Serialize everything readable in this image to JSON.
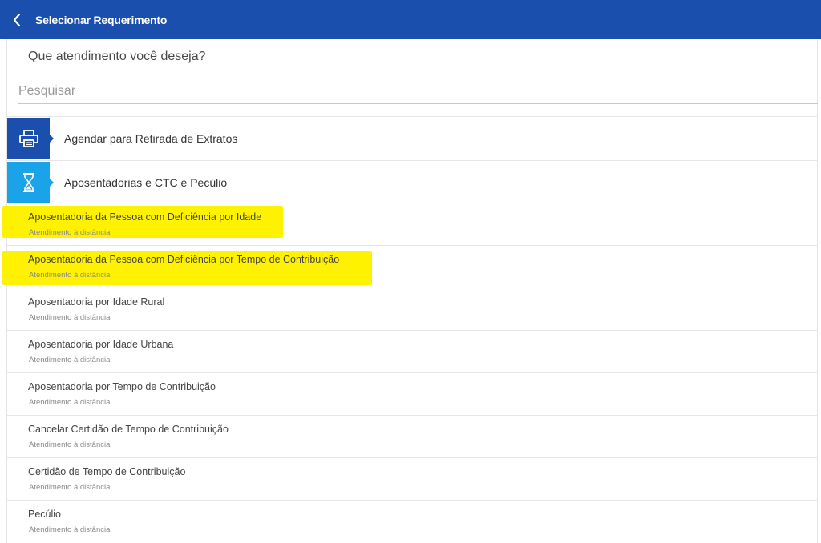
{
  "header": {
    "title": "Selecionar Requerimento",
    "back_icon": "chevron-left-icon",
    "background": "#1a4fae"
  },
  "question": "Que atendimento você deseja?",
  "search": {
    "placeholder": "Pesquisar",
    "value": ""
  },
  "categories": [
    {
      "label": "Agendar para Retirada de Extratos",
      "icon": "printer-icon",
      "color": "#1a4fae"
    },
    {
      "label": "Aposentadorias e CTC e Pecúlio",
      "icon": "hourglass-icon",
      "color": "#1aa3e8"
    }
  ],
  "items": [
    {
      "title": "Aposentadoria da Pessoa com Deficiência por Idade",
      "subtitle": "Atendimento à distância",
      "highlighted": true
    },
    {
      "title": "Aposentadoria da Pessoa com Deficiência por Tempo de Contribuição",
      "subtitle": "Atendimento à distância",
      "highlighted": true
    },
    {
      "title": "Aposentadoria por Idade Rural",
      "subtitle": "Atendimento à distância",
      "highlighted": false
    },
    {
      "title": "Aposentadoria por Idade Urbana",
      "subtitle": "Atendimento à distância",
      "highlighted": false
    },
    {
      "title": "Aposentadoria por Tempo de Contribuição",
      "subtitle": "Atendimento à distância",
      "highlighted": false
    },
    {
      "title": "Cancelar Certidão de Tempo de Contribuição",
      "subtitle": "Atendimento à distância",
      "highlighted": false
    },
    {
      "title": "Certidão de Tempo de Contribuição",
      "subtitle": "Atendimento à distância",
      "highlighted": false
    },
    {
      "title": "Pecúlio",
      "subtitle": "Atendimento à distância",
      "highlighted": false
    }
  ],
  "highlight_color": "#fff200"
}
